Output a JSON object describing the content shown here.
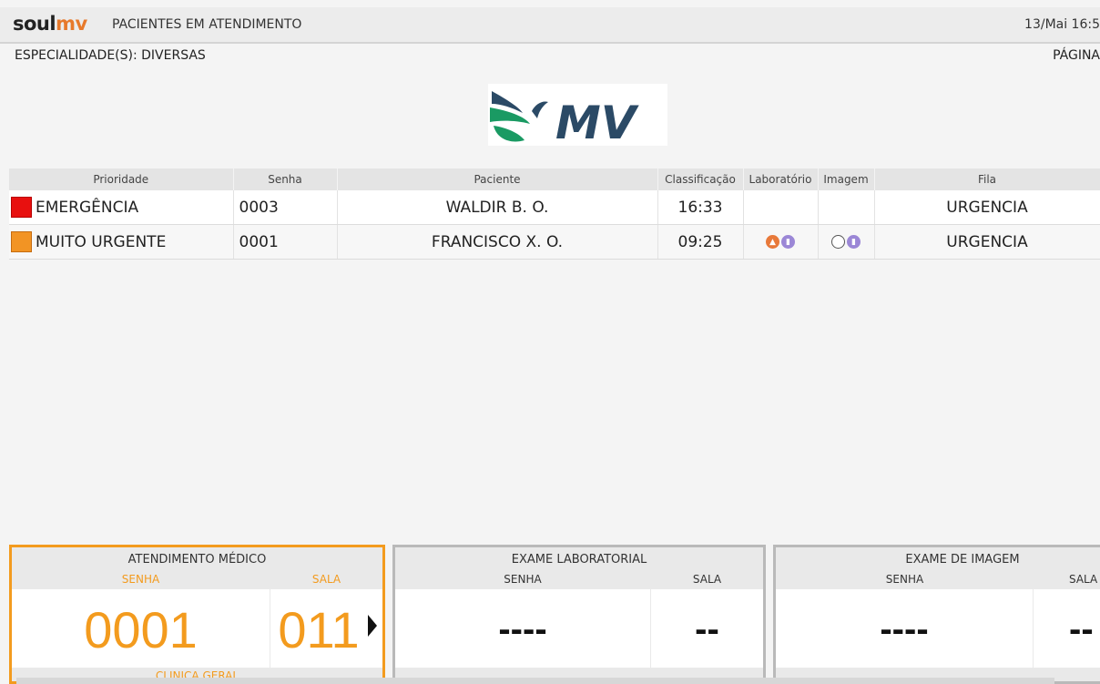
{
  "header": {
    "brand_part1": "soul",
    "brand_part2": "mv",
    "title": "PACIENTES EM ATENDIMENTO",
    "datetime": "13/Mai 16:5"
  },
  "subheader": {
    "specialty": "ESPECIALIDADE(S):  DIVERSAS",
    "page_label": "PÁGINA"
  },
  "center_logo": {
    "text": "MV",
    "icon": "mv-logo-icon"
  },
  "table": {
    "headers": [
      "Prioridade",
      "Senha",
      "Paciente",
      "Classificação",
      "Laboratório",
      "Imagem",
      "Fila"
    ],
    "rows": [
      {
        "priority": "EMERGÊNCIA",
        "priority_color": "#e8100f",
        "senha": "0003",
        "paciente": "WALDIR B. O.",
        "classificacao": "16:33",
        "laboratorio": [],
        "imagem": [],
        "fila": "URGENCIA"
      },
      {
        "priority": "MUITO URGENTE",
        "priority_color": "#f29424",
        "senha": "0001",
        "paciente": "FRANCISCO X. O.",
        "classificacao": "09:25",
        "laboratorio": [
          "lab-pending-icon",
          "document-icon"
        ],
        "imagem": [
          "empty-circle-icon",
          "document-icon"
        ],
        "fila": "URGENCIA"
      }
    ]
  },
  "panels": {
    "medico": {
      "title": "ATENDIMENTO MÉDICO",
      "senha_label": "SENHA",
      "sala_label": "SALA",
      "senha": "0001",
      "sala": "011",
      "footer": "CLINICA GERAL",
      "accent": "#f39b1e"
    },
    "laboratorio": {
      "title": "EXAME LABORATORIAL",
      "senha_label": "SENHA",
      "sala_label": "SALA",
      "senha": "----",
      "sala": "--"
    },
    "imagem": {
      "title": "EXAME DE IMAGEM",
      "senha_label": "SENHA",
      "sala_label": "SALA",
      "senha": "----",
      "sala": "--"
    }
  },
  "colors": {
    "accent_orange": "#f39b1e",
    "emergency_red": "#e8100f",
    "urgent_orange": "#f29424",
    "logo_green": "#1a9a63",
    "logo_navy": "#2b4a66",
    "status_purple": "#9b87d6"
  }
}
